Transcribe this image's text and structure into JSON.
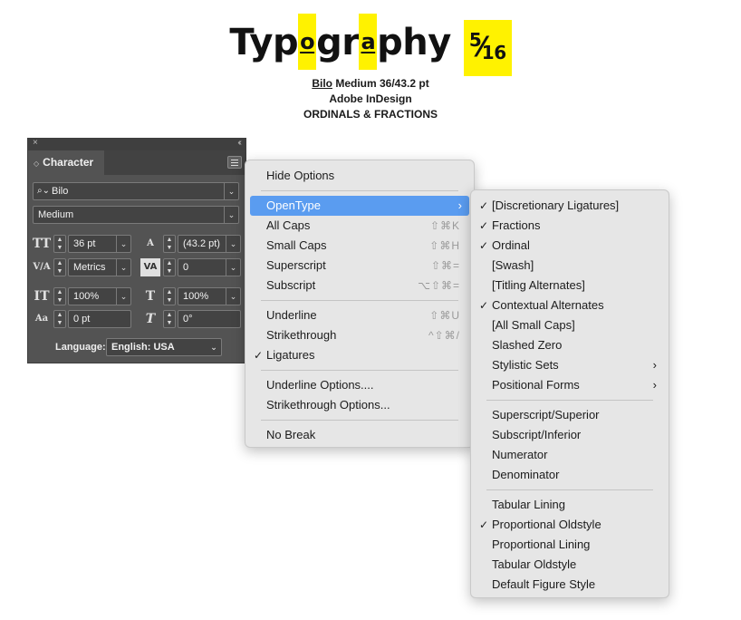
{
  "title": {
    "part1": "Typ",
    "hl_o": "o",
    "part2": "gr",
    "hl_a": "a",
    "part3": "phy",
    "frac_num": "5",
    "frac_slash": "⁄",
    "frac_den": "16",
    "line1_font": "Bilo",
    "line1_rest": " Medium 36/43.2 pt",
    "line2": "Adobe InDesign",
    "line3": "ORDINALS & FRACTIONS"
  },
  "panel": {
    "close": "×",
    "collapse": "‹‹",
    "tab_arrows": "◇",
    "tab_title": "Character",
    "font_family": "Bilo",
    "font_style": "Medium",
    "font_size": "36 pt",
    "leading": "(43.2 pt)",
    "kerning": "Metrics",
    "tracking": "0",
    "vertical_scale": "100%",
    "horizontal_scale": "100%",
    "baseline_shift": "0 pt",
    "skew": "0°",
    "language_label": "Language:",
    "language": "English: USA",
    "icons": {
      "size": "TT",
      "leading": "A",
      "kerning": "V/A",
      "tracking": "VA",
      "vscale": "IT",
      "hscale": "T",
      "baseline": "Aa",
      "skew": "T"
    }
  },
  "menu1": {
    "items": [
      {
        "label": "Hide Options",
        "shortcut": ""
      },
      {
        "label": "OpenType",
        "shortcut": "",
        "arrow": "›"
      },
      {
        "label": "All Caps",
        "shortcut": "⇧⌘K"
      },
      {
        "label": "Small Caps",
        "shortcut": "⇧⌘H"
      },
      {
        "label": "Superscript",
        "shortcut": "⇧⌘="
      },
      {
        "label": "Subscript",
        "shortcut": "⌥⇧⌘="
      },
      {
        "label": "Underline",
        "shortcut": "⇧⌘U"
      },
      {
        "label": "Strikethrough",
        "shortcut": "^⇧⌘/"
      },
      {
        "label": "Ligatures",
        "shortcut": "",
        "check": "✓"
      },
      {
        "label": "Underline Options....",
        "shortcut": ""
      },
      {
        "label": "Strikethrough Options...",
        "shortcut": ""
      },
      {
        "label": "No Break",
        "shortcut": ""
      }
    ]
  },
  "menu2": {
    "items": [
      {
        "label": "[Discretionary Ligatures]",
        "check": "✓"
      },
      {
        "label": "Fractions",
        "check": "✓"
      },
      {
        "label": "Ordinal",
        "check": "✓"
      },
      {
        "label": "[Swash]"
      },
      {
        "label": "[Titling Alternates]"
      },
      {
        "label": "Contextual Alternates",
        "check": "✓"
      },
      {
        "label": "[All Small Caps]"
      },
      {
        "label": "Slashed Zero"
      },
      {
        "label": "Stylistic Sets",
        "arrow": "›"
      },
      {
        "label": "Positional Forms",
        "arrow": "›"
      },
      {
        "label": "Superscript/Superior"
      },
      {
        "label": "Subscript/Inferior"
      },
      {
        "label": "Numerator"
      },
      {
        "label": "Denominator"
      },
      {
        "label": "Tabular Lining"
      },
      {
        "label": "Proportional Oldstyle",
        "check": "✓"
      },
      {
        "label": "Proportional Lining"
      },
      {
        "label": "Tabular Oldstyle"
      },
      {
        "label": "Default Figure Style"
      }
    ]
  },
  "colors": {
    "highlight": "#fff200",
    "menu_active": "#5a9cf0",
    "panel_bg": "#535353"
  }
}
